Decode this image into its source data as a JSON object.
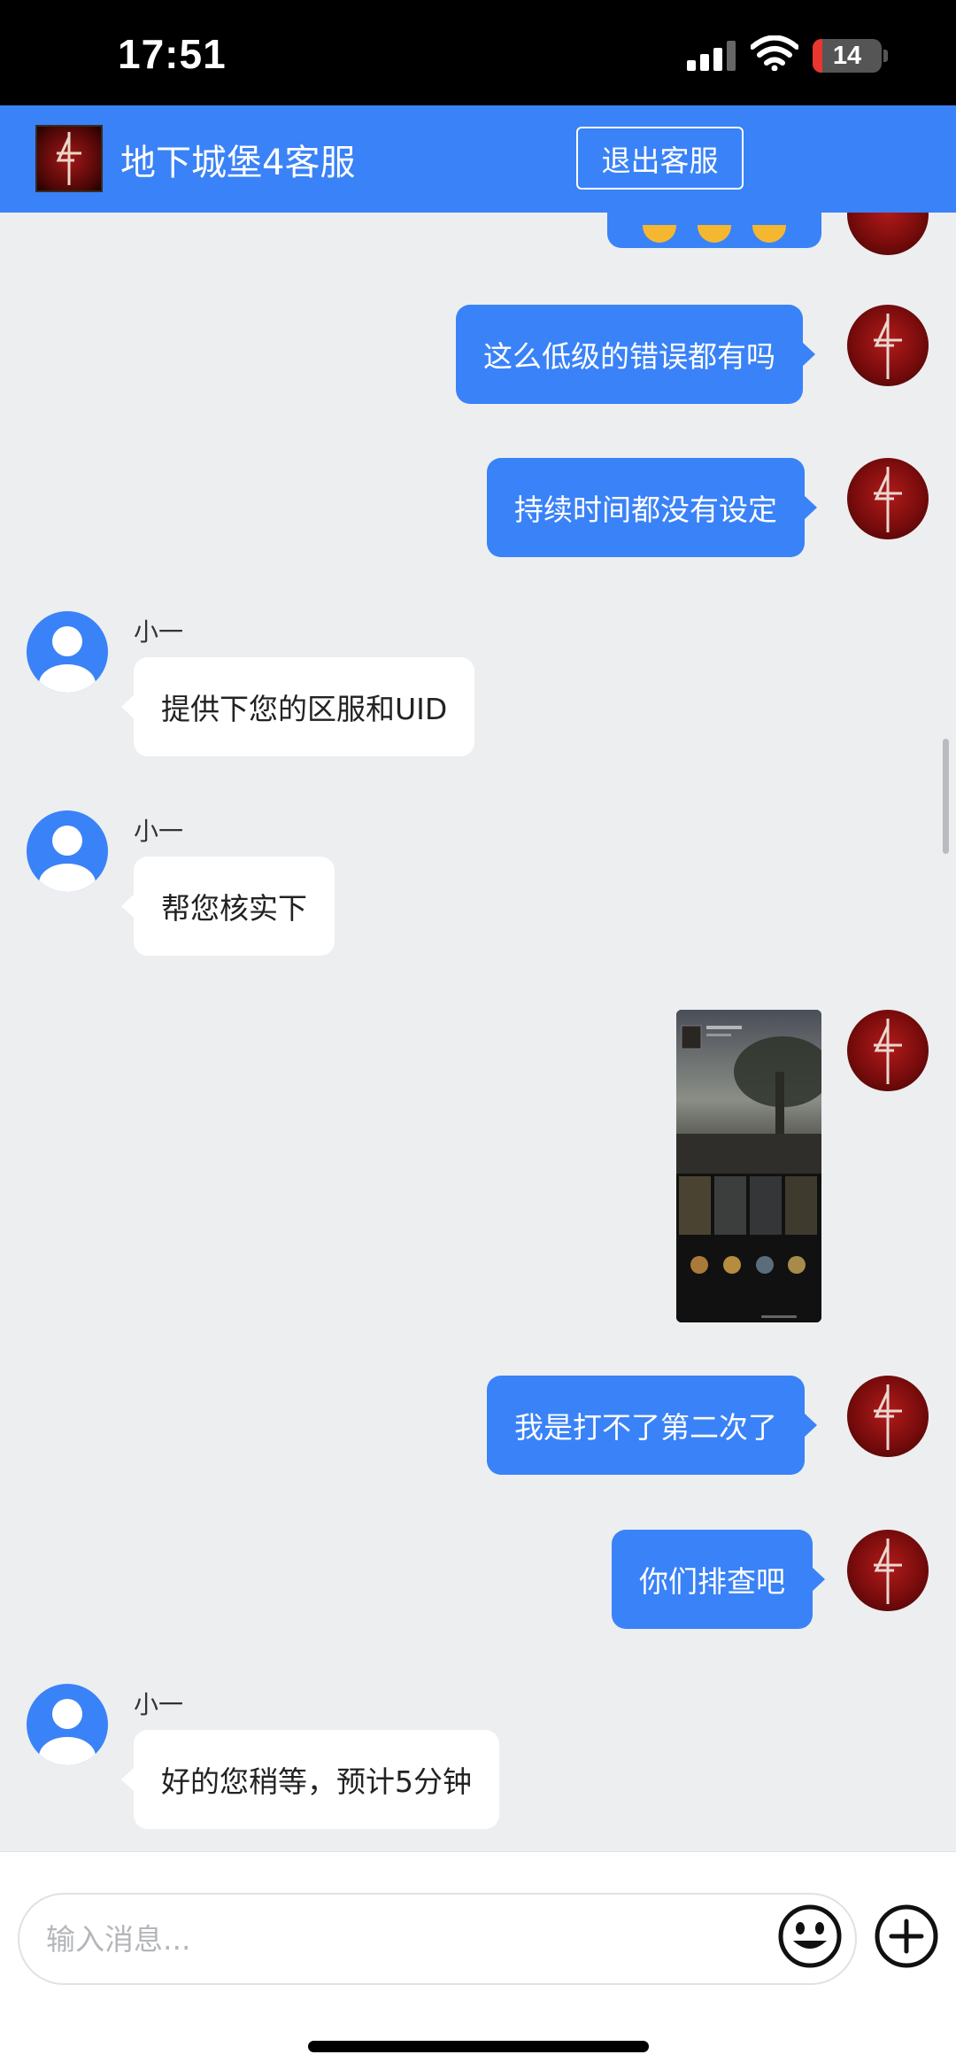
{
  "status_bar": {
    "time": "17:51",
    "battery": "14",
    "battery_fraction": 0.14
  },
  "header": {
    "title": "地下城堡4客服",
    "exit_label": "退出客服"
  },
  "messages": [
    {
      "dir": "out",
      "type": "text",
      "text": "这么低级的错误都有吗"
    },
    {
      "dir": "out",
      "type": "text",
      "text": "持续时间都没有设定"
    },
    {
      "dir": "in",
      "sender": "小一",
      "type": "text",
      "text": "提供下您的区服和UID"
    },
    {
      "dir": "in",
      "sender": "小一",
      "type": "text",
      "text": "帮您核实下"
    },
    {
      "dir": "out",
      "type": "image"
    },
    {
      "dir": "out",
      "type": "text",
      "text": "我是打不了第二次了"
    },
    {
      "dir": "out",
      "type": "text",
      "text": "你们排查吧"
    },
    {
      "dir": "in",
      "sender": "小一",
      "type": "text",
      "text": "好的您稍等，预计5分钟"
    }
  ],
  "input": {
    "placeholder": "输入消息..."
  },
  "icons": {
    "header_logo": "game-logo-icon",
    "emoji": "emoji-icon",
    "plus": "plus-icon",
    "user_avatar": "user-avatar-icon",
    "game_avatar": "game-avatar-icon"
  },
  "colors": {
    "accent": "#3a82f7",
    "background": "#edeef0",
    "incoming_bubble": "#ffffff"
  }
}
